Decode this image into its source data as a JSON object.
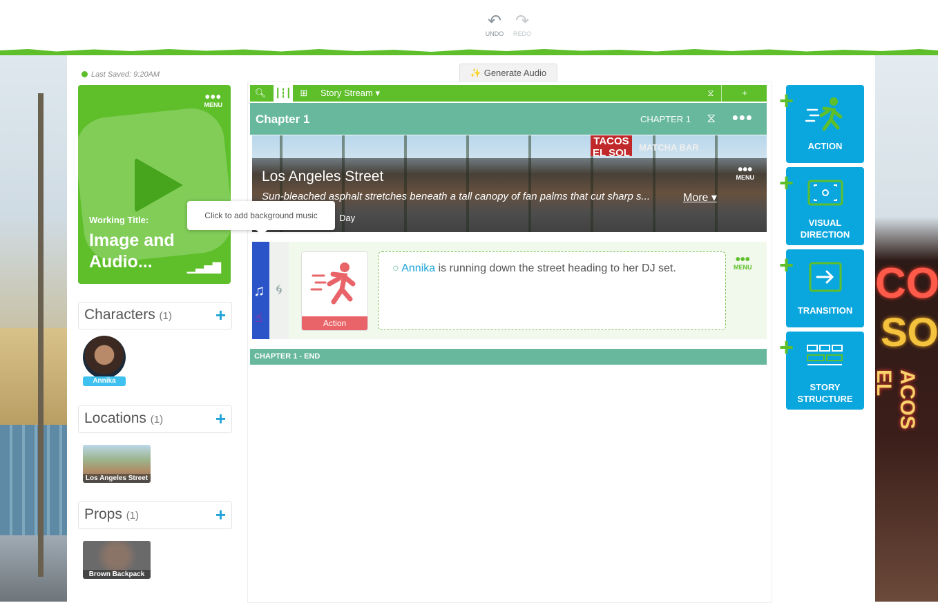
{
  "toolbar": {
    "undo_label": "UNDO",
    "redo_label": "REDO"
  },
  "status": {
    "last_saved": "Last Saved: 9:20AM"
  },
  "project": {
    "menu_label": "MENU",
    "working_title_label": "Working Title:",
    "title": "Image and Audio..."
  },
  "tooltip": {
    "text": "Click to add background music"
  },
  "sections": {
    "characters": {
      "label": "Characters",
      "count": "(1)",
      "items": [
        {
          "name": "Annika"
        }
      ]
    },
    "locations": {
      "label": "Locations",
      "count": "(1)",
      "items": [
        {
          "name": "Los Angeles Street"
        }
      ]
    },
    "props": {
      "label": "Props",
      "count": "(1)",
      "items": [
        {
          "name": "Brown Backpack"
        }
      ]
    }
  },
  "generate_audio": {
    "label": "Generate Audio"
  },
  "stream": {
    "title": "Story Stream ▾",
    "plus_label": "+",
    "chapter": {
      "name": "Chapter 1",
      "label": "CHAPTER 1",
      "end_label": "CHAPTER 1 - END"
    },
    "location_block": {
      "title": "Los Angeles Street",
      "description": "Sun-bleached asphalt stretches beneath a tall canopy of fan palms that cut sharp s...",
      "more_label": "More ▾",
      "time": "Day",
      "menu_label": "MENU",
      "sign_1": "TACOS EL SOL",
      "sign_2": "MATCHA BAR"
    },
    "action_block": {
      "card_label": "Action",
      "character": "Annika",
      "text": " is running down the street heading to her DJ set.",
      "menu_label": "MENU"
    }
  },
  "tiles": [
    {
      "label": "ACTION"
    },
    {
      "label": "VISUAL DIRECTION"
    },
    {
      "label": "TRANSITION"
    },
    {
      "label": "STORY STRUCTURE"
    }
  ],
  "background": {
    "neon_1": "COS",
    "neon_2": "SOL",
    "neon_3": "ACOS EL SOL"
  },
  "colors": {
    "brand_green": "#5ebf2a",
    "teal": "#67b89d",
    "blue": "#0aa6de",
    "music_bar": "#2b54c8",
    "action_red": "#e86468"
  }
}
